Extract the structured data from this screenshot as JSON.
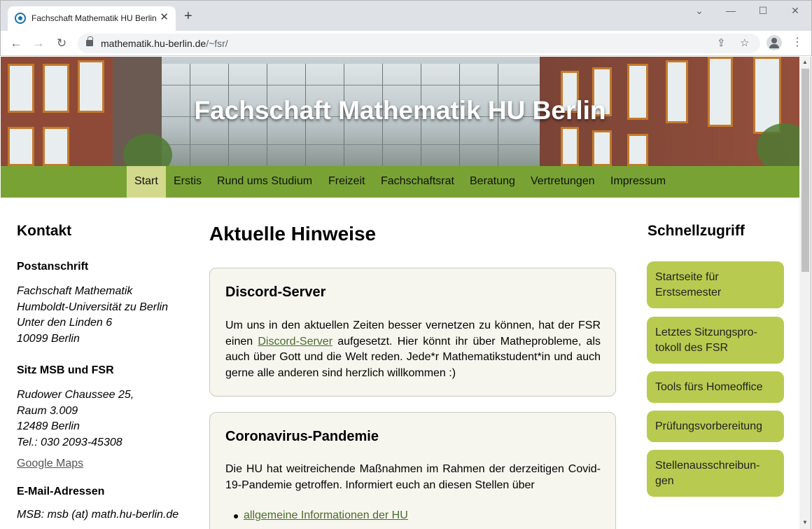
{
  "browser": {
    "tab_title": "Fachschaft Mathematik HU Berlin",
    "url_host": "mathematik.hu-berlin.de",
    "url_path": "/~fsr/"
  },
  "hero": {
    "title": "Fachschaft Mathematik HU Berlin"
  },
  "nav": {
    "items": [
      "Start",
      "Erstis",
      "Rund ums Studium",
      "Freizeit",
      "Fachschaftsrat",
      "Beratung",
      "Vertretungen",
      "Impressum"
    ],
    "active": "Start"
  },
  "kontakt": {
    "heading": "Kontakt",
    "post_heading": "Postanschrift",
    "post_lines": [
      "Fachschaft Mathematik",
      "Humboldt-Universität zu Berlin",
      "Unter den Linden 6",
      "10099 Berlin"
    ],
    "sitz_heading": "Sitz MSB und FSR",
    "sitz_lines": [
      "Rudower Chaussee 25,",
      "Raum 3.009",
      "12489 Berlin",
      "Tel.: 030 2093-45308"
    ],
    "maps_link": "Google Maps",
    "email_heading": "E-Mail-Adressen",
    "email_line": "MSB: msb (at) math.hu-berlin.de"
  },
  "main": {
    "title": "Aktuelle Hinweise",
    "cards": [
      {
        "title": "Discord-Server",
        "text_before": "Um uns in den aktuellen Zeiten besser vernetzen zu können, hat der FSR einen ",
        "link": "Discord-Server",
        "text_after": " aufgesetzt. Hier könnt ihr über Matheprobleme, als auch über Gott und die Welt reden. Jede*r Mathematikstudent*in und auch gerne alle anderen sind herzlich willkommen :)"
      },
      {
        "title": "Coronavirus-Pandemie",
        "text": "Die HU hat weitreichende Maßnahmen im Rahmen der derzeitigen Covid-19-Pandemie getroffen. Informiert euch an diesen Stellen über",
        "bullet_link": "allgemeine Informationen der HU"
      }
    ]
  },
  "schnellzugriff": {
    "heading": "Schnellzugriff",
    "items": [
      "Startseite für Erstsemester",
      "Letztes Sitzungspro-tokoll des FSR",
      "Tools fürs Homeoffice",
      "Prüfungsvorbereitung",
      "Stellenausschreibun-gen"
    ]
  }
}
